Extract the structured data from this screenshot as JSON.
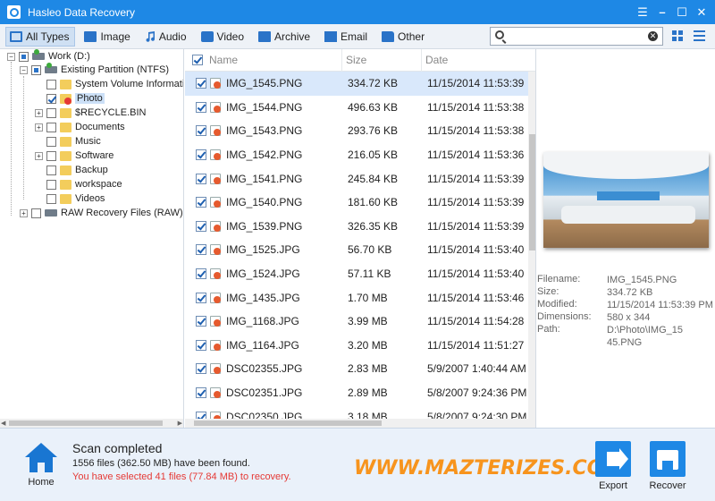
{
  "window": {
    "title": "Hasleo Data Recovery"
  },
  "toolbar": {
    "tabs": [
      {
        "label": "All Types",
        "icon": "monitor-icon"
      },
      {
        "label": "Image",
        "icon": "image-icon"
      },
      {
        "label": "Audio",
        "icon": "music-note-icon"
      },
      {
        "label": "Video",
        "icon": "video-camera-icon"
      },
      {
        "label": "Archive",
        "icon": "archive-icon"
      },
      {
        "label": "Email",
        "icon": "envelope-icon"
      },
      {
        "label": "Other",
        "icon": "folder-icon"
      }
    ],
    "search": {
      "value": "",
      "placeholder": ""
    }
  },
  "tree": {
    "items": [
      {
        "label": "Work (D:)"
      },
      {
        "label": "Existing Partition (NTFS)"
      },
      {
        "label": "System Volume Informati"
      },
      {
        "label": "Photo"
      },
      {
        "label": "$RECYCLE.BIN"
      },
      {
        "label": "Documents"
      },
      {
        "label": "Music"
      },
      {
        "label": "Software"
      },
      {
        "label": "Backup"
      },
      {
        "label": "workspace"
      },
      {
        "label": "Videos"
      },
      {
        "label": "RAW Recovery Files (RAW)"
      }
    ]
  },
  "filelist": {
    "columns": {
      "name": "Name",
      "size": "Size",
      "date": "Date"
    },
    "rows": [
      {
        "name": "IMG_1545.PNG",
        "size": "334.72 KB",
        "date": "11/15/2014 11:53:39"
      },
      {
        "name": "IMG_1544.PNG",
        "size": "496.63 KB",
        "date": "11/15/2014 11:53:38"
      },
      {
        "name": "IMG_1543.PNG",
        "size": "293.76 KB",
        "date": "11/15/2014 11:53:38"
      },
      {
        "name": "IMG_1542.PNG",
        "size": "216.05 KB",
        "date": "11/15/2014 11:53:36"
      },
      {
        "name": "IMG_1541.PNG",
        "size": "245.84 KB",
        "date": "11/15/2014 11:53:39"
      },
      {
        "name": "IMG_1540.PNG",
        "size": "181.60 KB",
        "date": "11/15/2014 11:53:39"
      },
      {
        "name": "IMG_1539.PNG",
        "size": "326.35 KB",
        "date": "11/15/2014 11:53:39"
      },
      {
        "name": "IMG_1525.JPG",
        "size": "56.70 KB",
        "date": "11/15/2014 11:53:40"
      },
      {
        "name": "IMG_1524.JPG",
        "size": "57.11 KB",
        "date": "11/15/2014 11:53:40"
      },
      {
        "name": "IMG_1435.JPG",
        "size": "1.70 MB",
        "date": "11/15/2014 11:53:46"
      },
      {
        "name": "IMG_1168.JPG",
        "size": "3.99 MB",
        "date": "11/15/2014 11:54:28"
      },
      {
        "name": "IMG_1164.JPG",
        "size": "3.20 MB",
        "date": "11/15/2014 11:51:27"
      },
      {
        "name": "DSC02355.JPG",
        "size": "2.83 MB",
        "date": "5/9/2007 1:40:44 AM"
      },
      {
        "name": "DSC02351.JPG",
        "size": "2.89 MB",
        "date": "5/8/2007 9:24:36 PM"
      },
      {
        "name": "DSC02350.JPG",
        "size": "3.18 MB",
        "date": "5/8/2007 9:24:30 PM"
      }
    ]
  },
  "preview": {
    "filename_key": "Filename:",
    "filename": "IMG_1545.PNG",
    "size_key": "Size:",
    "size": "334.72 KB",
    "modified_key": "Modified:",
    "modified": "11/15/2014 11:53:39 PM",
    "dimensions_key": "Dimensions:",
    "dimensions": "580 x 344",
    "path_key": "Path:",
    "path": "D:\\Photo\\IMG_1545.PNG"
  },
  "status": {
    "home_label": "Home",
    "title": "Scan completed",
    "found": "1556 files (362.50 MB) have been found.",
    "selected": "You have selected 41 files (77.84 MB) to recovery.",
    "watermark": "WWW.MAZTERIZES.COM",
    "export_label": "Export",
    "recover_label": "Recover"
  },
  "colors": {
    "accent": "#1e88e5",
    "warning": "#e53935",
    "watermark": "#f7941d"
  }
}
